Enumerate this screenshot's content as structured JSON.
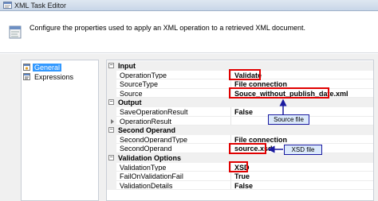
{
  "window": {
    "title": "XML Task Editor"
  },
  "header": {
    "description": "Configure the properties used to apply an XML operation to a retrieved XML document."
  },
  "nav": {
    "items": [
      {
        "label": "General"
      },
      {
        "label": "Expressions"
      }
    ]
  },
  "grid": {
    "input_label": "Input",
    "operation_type_label": "OperationType",
    "operation_type_value": "Validate",
    "source_type_label": "SourceType",
    "source_type_value": "File connection",
    "source_label": "Source",
    "source_value": "Souce_without_publish_date.xml",
    "output_label": "Output",
    "save_result_label": "SaveOperationResult",
    "save_result_value": "False",
    "operation_result_label": "OperationResult",
    "second_operand_label": "Second Operand",
    "second_operand_type_label": "SecondOperandType",
    "second_operand_type_value": "File connection",
    "second_operand_prop_label": "SecondOperand",
    "second_operand_prop_value": "source.xsd",
    "validation_options_label": "Validation Options",
    "validation_type_label": "ValidationType",
    "validation_type_value": "XSD",
    "fail_label": "FailOnValidationFail",
    "fail_value": "True",
    "details_label": "ValidationDetails",
    "details_value": "False"
  },
  "annotations": {
    "source_file": "Source file",
    "xsd_file": "XSD file"
  }
}
